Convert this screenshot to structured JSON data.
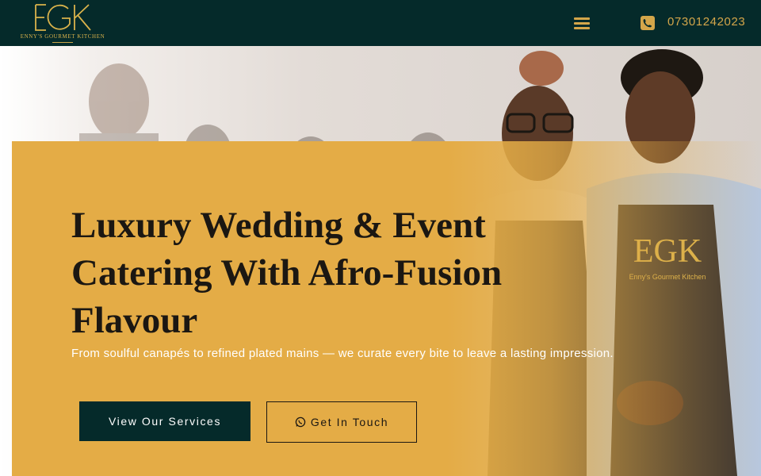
{
  "header": {
    "logo": {
      "mark": "EGK",
      "subtitle": "ENNY'S GOURMET KITCHEN"
    },
    "menu_icon": "menu-icon",
    "phone_icon": "phone-icon",
    "phone_number": "07301242023"
  },
  "hero": {
    "heading": "Luxury Wedding & Event Catering With Afro-Fusion Flavour",
    "subheading": "From soulful canapés to refined plated mains — we curate every bite to leave a lasting impression.",
    "primary_button": "View Our Services",
    "secondary_button": "Get In Touch",
    "secondary_button_icon": "whatsapp-icon"
  },
  "colors": {
    "header_bg": "#052a2a",
    "accent_gold": "#d4a64a",
    "panel_gold": "#e4ac46",
    "text_dark": "#1b1712"
  }
}
